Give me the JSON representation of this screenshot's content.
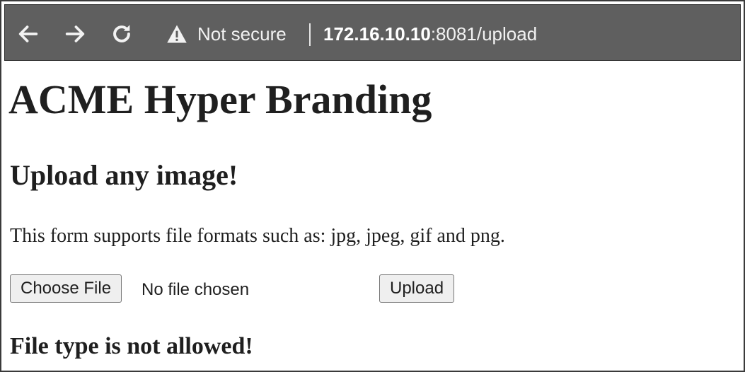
{
  "browser": {
    "security_label": "Not secure",
    "url_host": "172.16.10.10",
    "url_rest": ":8081/upload",
    "icons": {
      "back": "back-arrow-icon",
      "forward": "forward-arrow-icon",
      "reload": "reload-icon",
      "security": "warning-triangle-icon"
    },
    "toolbar_color": "#5f5f5f"
  },
  "page": {
    "title": "ACME Hyper Branding",
    "subtitle": "Upload any image!",
    "description": "This form supports file formats such as: jpg, jpeg, gif and png.",
    "file_input": {
      "button_label": "Choose File",
      "status": "No file chosen"
    },
    "upload_label": "Upload",
    "error_message": "File type is not allowed!"
  }
}
